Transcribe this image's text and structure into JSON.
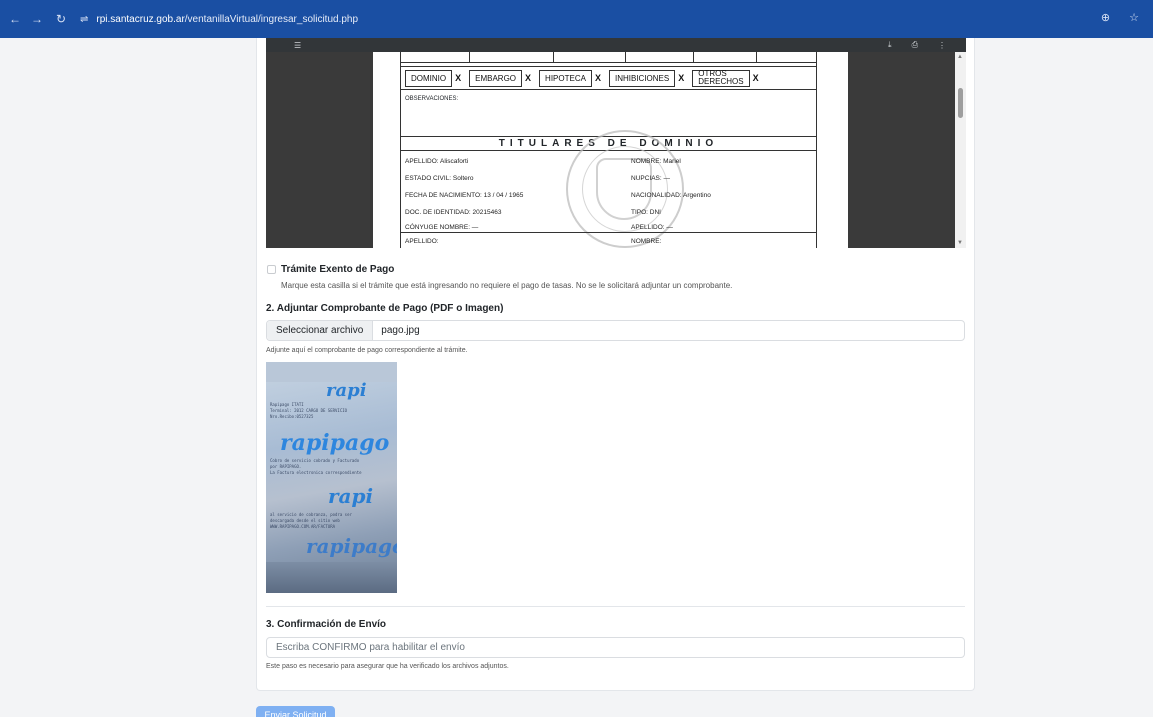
{
  "browser": {
    "url_host": "rpi.santacruz.gob.ar",
    "url_path": "/ventanillaVirtual/ingresar_solicitud.php",
    "back_glyph": "←",
    "forward_glyph": "→",
    "reload_glyph": "↻",
    "tune_glyph": "⇌",
    "zoom_glyph": "⊕",
    "star_glyph": "☆"
  },
  "pdf_viewer": {
    "rows": {
      "dominio": "DOMINIO",
      "embargo": "EMBARGO",
      "hipoteca": "HIPOTECA",
      "inhibiciones": "INHIBICIONES",
      "otros_1": "OTROS",
      "otros_2": "DERECHOS",
      "x": "X"
    },
    "observaciones": "OBSERVACIONES:",
    "titulares_title": "TITULARES DE DOMINIO",
    "fields": {
      "apellido": "APELLIDO: Aliscaforti",
      "nombre": "NOMBRE: Mariel",
      "estado_civil": "ESTADO CIVIL: Soltero",
      "nupcias": "NUPCIAS: —",
      "fecha_nacimiento": "FECHA DE NACIMIENTO:  13  /  04  /  1965",
      "nacionalidad": "NACIONALIDAD: Argentino",
      "doc_identidad": "DOC. DE IDENTIDAD:  20215463",
      "tipo": "TIPO: DNI",
      "conyuge": "CÓNYUGE NOMBRE:  —",
      "apellido_conyuge": "APELLIDO: —",
      "apellido2": "APELLIDO:",
      "nombre2": "NOMBRE:"
    }
  },
  "exento": {
    "label": "Trámite Exento de Pago",
    "help": "Marque esta casilla si el trámite que está ingresando no requiere el pago de tasas. No se le solicitará adjuntar un comprobante.",
    "checked": false
  },
  "section2": {
    "title": "2. Adjuntar Comprobante de Pago (PDF o Imagen)",
    "button": "Seleccionar archivo",
    "filename": "pago.jpg",
    "help": "Adjunte aquí el comprobante de pago correspondiente al trámite."
  },
  "receipt_preview": {
    "brand": "rapi",
    "brand_big": "rapipago",
    "lines": [
      "Cobro de servicio cobrado y Facturado",
      "por RAPIPAGO.",
      "La Factura electronica correspondiente",
      "al servicio de cobranza, podra ser",
      "descargada desde el sitio web",
      "WWW.RAPIPAGO.COM.AR/FACTURA"
    ]
  },
  "section3": {
    "title": "3. Confirmación de Envío",
    "placeholder": "Escriba CONFIRMO para habilitar el envío",
    "help": "Este paso es necesario para asegurar que ha verificado los archivos adjuntos."
  },
  "submit_label": "Enviar Solicitud"
}
